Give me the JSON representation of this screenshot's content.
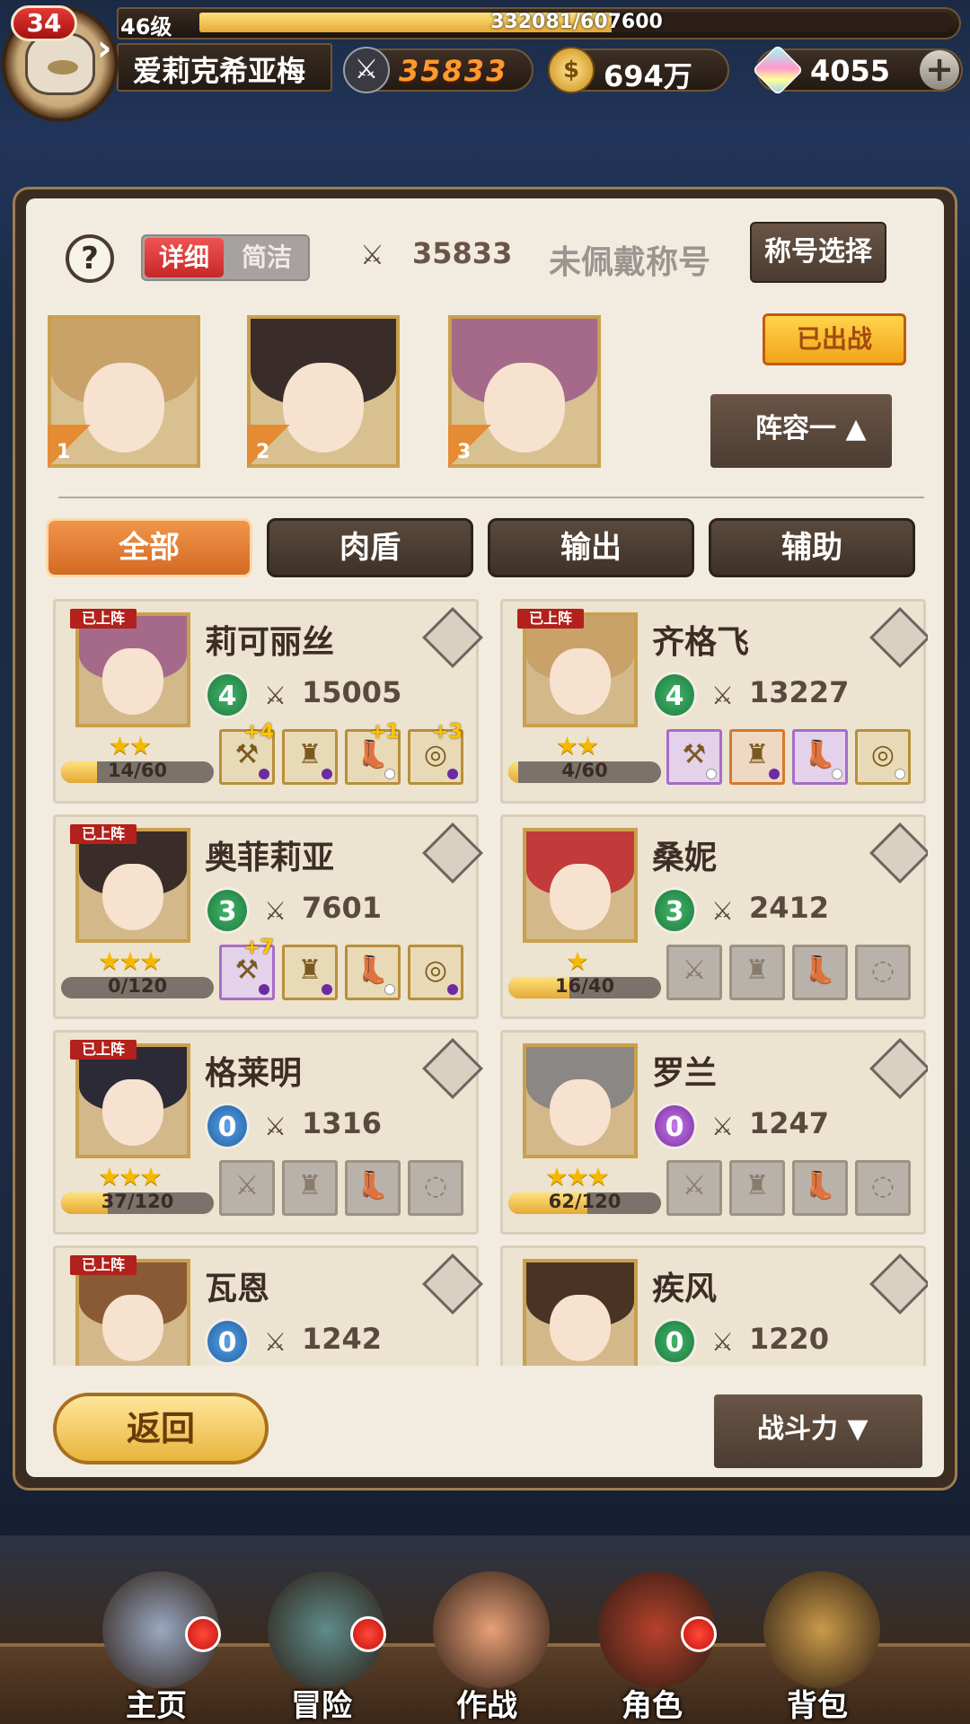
{
  "top_bar": {
    "player_level_badge": "34",
    "level_label": "46级",
    "exp_text": "332081/607600",
    "exp_fraction": 0.546,
    "player_name": "爱莉克希亚梅",
    "combat_power": "35833",
    "gold": "694万",
    "gems": "4055",
    "icons": {
      "power": "crossed-swords-icon",
      "gold": "gold-coin-icon",
      "gem": "crystal-gem-icon",
      "plus": "plus-icon"
    }
  },
  "panel": {
    "view_toggle": {
      "detail": "详细",
      "simple": "简洁"
    },
    "team_power": "35833",
    "title_status": "未佩戴称号",
    "title_select_button": "称号选择",
    "deployed_badge": "已出战",
    "lineup_button": "阵容一",
    "team_slots": [
      "1",
      "2",
      "3"
    ],
    "filter_tabs": [
      "全部",
      "肉盾",
      "输出",
      "辅助"
    ],
    "back_button": "返回",
    "sort_button": "战斗力",
    "deployed_tag": "已上阵"
  },
  "heroes": [
    {
      "name": "莉可丽丝",
      "deployed": true,
      "class_level": "4",
      "class_color": "green",
      "power": "15005",
      "stars": "★★",
      "shard_text": "14/60",
      "shard_fraction": 0.233,
      "hair": "#a56a8a",
      "slots": [
        {
          "plus": "+4",
          "gem": "purple",
          "glyph": "⚒"
        },
        {
          "plus": "",
          "gem": "purple",
          "glyph": "♜"
        },
        {
          "plus": "+1",
          "gem": "white",
          "glyph": "👢"
        },
        {
          "plus": "+3",
          "gem": "purple",
          "glyph": "◎"
        }
      ]
    },
    {
      "name": "齐格飞",
      "deployed": true,
      "class_level": "4",
      "class_color": "green",
      "power": "13227",
      "stars": "★★",
      "shard_text": "4/60",
      "shard_fraction": 0.067,
      "hair": "#c9a26a",
      "slots": [
        {
          "plus": "",
          "gem": "white",
          "glyph": "⚒",
          "frame": "purple"
        },
        {
          "plus": "",
          "gem": "purple",
          "glyph": "♜",
          "frame": "orange"
        },
        {
          "plus": "",
          "gem": "white",
          "glyph": "👢",
          "frame": "purple"
        },
        {
          "plus": "",
          "gem": "white",
          "glyph": "◎"
        }
      ]
    },
    {
      "name": "奥菲莉亚",
      "deployed": true,
      "class_level": "3",
      "class_color": "green",
      "power": "7601",
      "stars": "★★★",
      "shard_text": "0/120",
      "shard_fraction": 0,
      "hair": "#3a2c28",
      "slots": [
        {
          "plus": "+7",
          "gem": "purple",
          "glyph": "⚒",
          "frame": "purple"
        },
        {
          "plus": "",
          "gem": "purple",
          "glyph": "♜"
        },
        {
          "plus": "",
          "gem": "white",
          "glyph": "👢"
        },
        {
          "plus": "",
          "gem": "purple",
          "glyph": "◎"
        }
      ]
    },
    {
      "name": "桑妮",
      "deployed": false,
      "class_level": "3",
      "class_color": "green",
      "power": "2412",
      "stars": "★",
      "shard_text": "16/40",
      "shard_fraction": 0.4,
      "hair": "#c23a3a",
      "slots": [
        {
          "glyph": "⚔",
          "empty": true
        },
        {
          "glyph": "♜",
          "empty": true
        },
        {
          "glyph": "👢",
          "empty": true
        },
        {
          "glyph": "◌",
          "empty": true
        }
      ]
    },
    {
      "name": "格莱明",
      "deployed": true,
      "class_level": "0",
      "class_color": "blue",
      "power": "1316",
      "stars": "★★★",
      "shard_text": "37/120",
      "shard_fraction": 0.308,
      "hair": "#2b2a36",
      "slots": [
        {
          "glyph": "⚔",
          "empty": true
        },
        {
          "glyph": "♜",
          "empty": true
        },
        {
          "glyph": "👢",
          "empty": true
        },
        {
          "glyph": "◌",
          "empty": true
        }
      ]
    },
    {
      "name": "罗兰",
      "deployed": false,
      "class_level": "0",
      "class_color": "purple",
      "power": "1247",
      "stars": "★★★",
      "shard_text": "62/120",
      "shard_fraction": 0.517,
      "hair": "#8a8784",
      "slots": [
        {
          "glyph": "⚔",
          "empty": true
        },
        {
          "glyph": "♜",
          "empty": true
        },
        {
          "glyph": "👢",
          "empty": true
        },
        {
          "glyph": "◌",
          "empty": true
        }
      ]
    },
    {
      "name": "瓦恩",
      "deployed": true,
      "class_level": "0",
      "class_color": "blue",
      "power": "1242",
      "stars": "",
      "shard_text": "",
      "shard_fraction": 0,
      "hair": "#8a5a35",
      "slots": []
    },
    {
      "name": "疾风",
      "deployed": false,
      "class_level": "0",
      "class_color": "green",
      "power": "1220",
      "stars": "",
      "shard_text": "",
      "shard_fraction": 0,
      "hair": "#4a3224",
      "slots": []
    }
  ],
  "bottom_nav": [
    {
      "label": "主页",
      "badge": true,
      "icon": "castle-icon"
    },
    {
      "label": "冒险",
      "badge": true,
      "icon": "gate-icon"
    },
    {
      "label": "作战",
      "badge": false,
      "icon": "warrior-icon"
    },
    {
      "label": "角色",
      "badge": true,
      "icon": "book-icon"
    },
    {
      "label": "背包",
      "badge": false,
      "icon": "backpack-icon"
    }
  ],
  "colors": {
    "accent_orange": "#e48b33",
    "deployed_red": "#b2211b",
    "frame_gold": "#c9a04d",
    "panel_bg": "#f2ece0"
  }
}
